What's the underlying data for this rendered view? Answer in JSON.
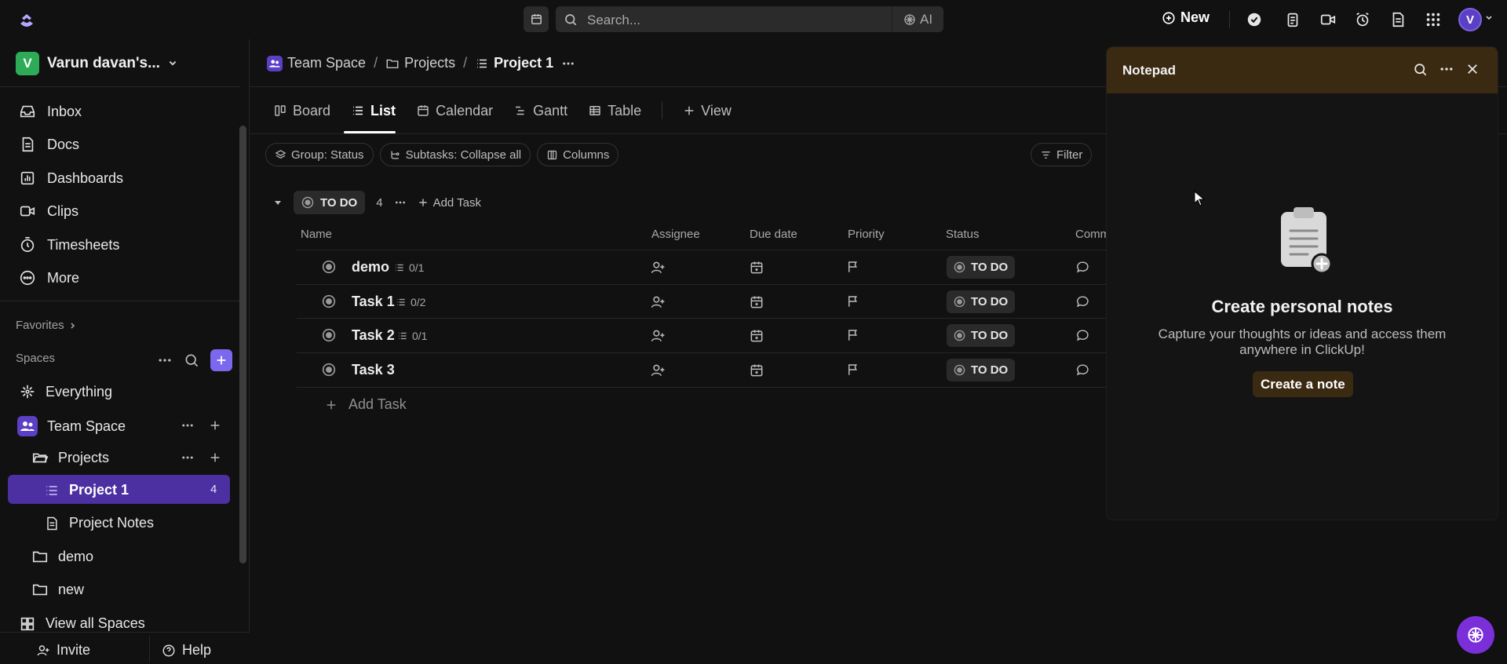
{
  "topbar": {
    "search_placeholder": "Search...",
    "ai_label": "AI",
    "new_label": "New",
    "avatar_initial": "V"
  },
  "sidebar": {
    "workspace_initial": "V",
    "workspace_name": "Varun davan's...",
    "nav": [
      "Inbox",
      "Docs",
      "Dashboards",
      "Clips",
      "Timesheets",
      "More"
    ],
    "favorites_label": "Favorites",
    "spaces_label": "Spaces",
    "tree": {
      "everything": "Everything",
      "team_space": "Team Space",
      "projects": "Projects",
      "project1": "Project 1",
      "project1_count": "4",
      "project_notes": "Project Notes",
      "demo": "demo",
      "new": "new",
      "view_all": "View all Spaces"
    },
    "invite_label": "Invite",
    "help_label": "Help"
  },
  "main": {
    "breadcrumb": [
      "Team Space",
      "Projects",
      "Project 1"
    ],
    "views": [
      "Board",
      "List",
      "Calendar",
      "Gantt",
      "Table",
      "View"
    ],
    "active_view": "List",
    "chips": [
      "Group: Status",
      "Subtasks: Collapse all",
      "Columns"
    ],
    "filter_label": "Filter",
    "group": {
      "status": "TO DO",
      "count": "4",
      "add_task": "Add Task"
    },
    "columns": [
      "Name",
      "Assignee",
      "Due date",
      "Priority",
      "Status",
      "Comm"
    ],
    "tasks": [
      {
        "name": "demo",
        "subtasks": "0/1",
        "status": "TO DO"
      },
      {
        "name": "Task 1",
        "subtasks": "0/2",
        "status": "TO DO"
      },
      {
        "name": "Task 2",
        "subtasks": "0/1",
        "status": "TO DO"
      },
      {
        "name": "Task 3",
        "subtasks": "",
        "status": "TO DO"
      }
    ],
    "add_task_label": "Add Task"
  },
  "notepad": {
    "title": "Notepad",
    "heading": "Create personal notes",
    "description": "Capture your thoughts or ideas and access them anywhere in ClickUp!",
    "button": "Create a note"
  },
  "colors": {
    "accent": "#7b68ee",
    "active_bg": "#4c2fa0",
    "notepad_header": "#3a2a12"
  }
}
